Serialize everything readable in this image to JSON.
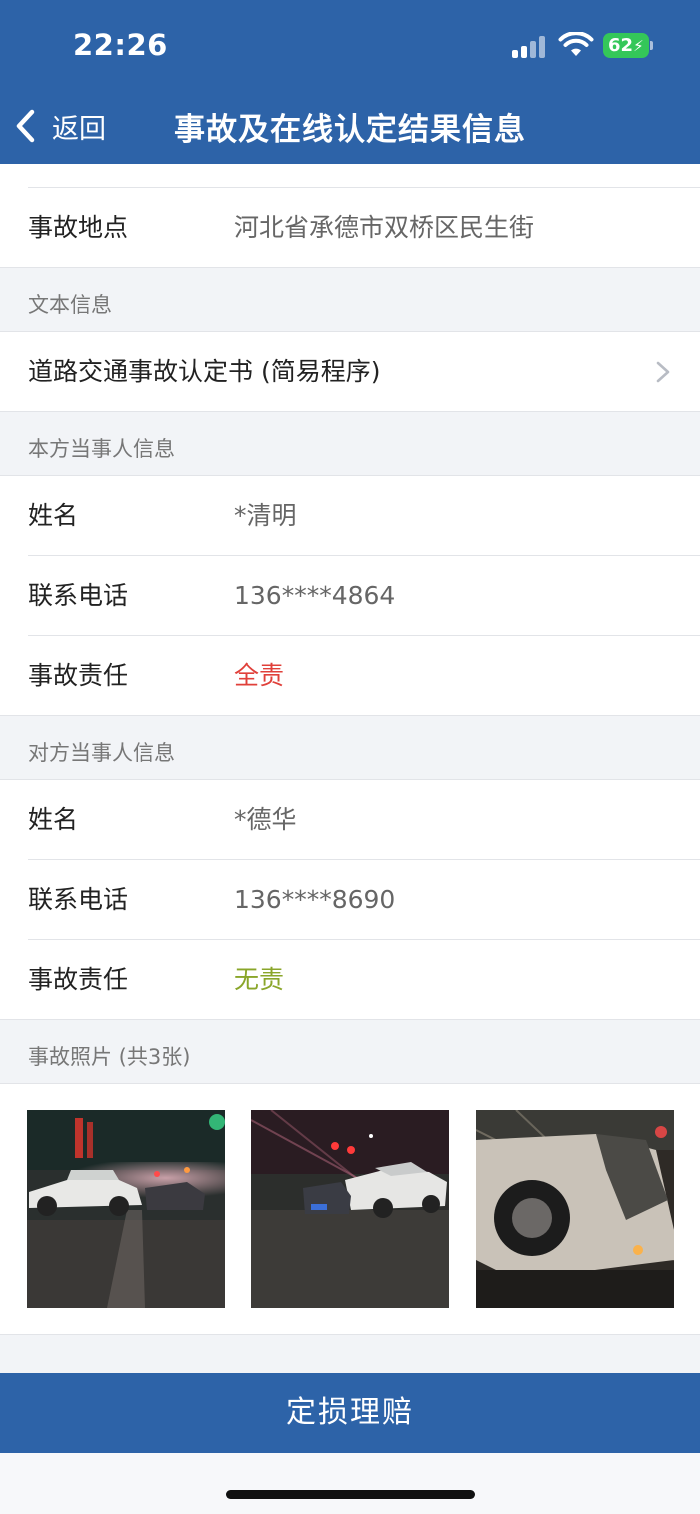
{
  "status": {
    "time": "22:26",
    "battery": "62"
  },
  "nav": {
    "back_label": "返回",
    "title": "事故及在线认定结果信息"
  },
  "accident": {
    "location_label": "事故地点",
    "location_value": "河北省承德市双桥区民生街"
  },
  "text_info": {
    "section_title": "文本信息",
    "document_link": "道路交通事故认定书 (简易程序)"
  },
  "own_party": {
    "section_title": "本方当事人信息",
    "rows": [
      {
        "label": "姓名",
        "value": "*清明"
      },
      {
        "label": "联系电话",
        "value": "136****4864"
      },
      {
        "label": "事故责任",
        "value": "全责"
      }
    ]
  },
  "other_party": {
    "section_title": "对方当事人信息",
    "rows": [
      {
        "label": "姓名",
        "value": "*德华"
      },
      {
        "label": "联系电话",
        "value": "136****8690"
      },
      {
        "label": "事故责任",
        "value": "无责"
      }
    ]
  },
  "photos": {
    "section_title": "事故照片 (共3张)",
    "count": 3
  },
  "colors": {
    "primary": "#2d63a8",
    "full_liability": "#e0403a",
    "no_liability": "#8aa62a"
  },
  "action": {
    "button_label": "定损理赔"
  }
}
